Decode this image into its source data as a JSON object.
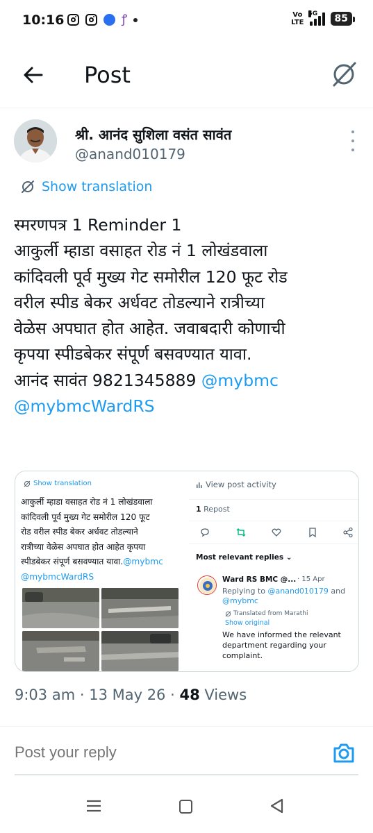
{
  "status_bar": {
    "time": "10:16",
    "network_label_top": "Vo",
    "network_label_bottom": "LTE",
    "network_5g": "5G",
    "battery": "85"
  },
  "header": {
    "title": "Post"
  },
  "author": {
    "name": "श्री. आनंद सुशिला वसंत सावंत",
    "handle": "@anand010179"
  },
  "translate_label": "Show translation",
  "post": {
    "lines": [
      "स्मरणपत्र 1 Reminder 1",
      "आकुर्ली म्हाडा वसाहत रोड नं 1 लोखंडवाला",
      "कांदिवली पूर्व मुख्य गेट समोरील 120 फूट रोड",
      "वरील स्पीड बेकर अर्धवट तोडल्याने रात्रीच्या",
      "वेळेस अपघात होत आहेत. जवाबदारी कोणाची",
      "कृपया स्पीडबेकर संपूर्ण बसवण्यात यावा."
    ],
    "last_line_text": "आनंद सावंत 9821345889 ",
    "mention_1": "@mybmc",
    "mention_2": "@mybmcWardRS"
  },
  "media": {
    "left": {
      "translate_label": "Show translation",
      "lines": [
        "आकुर्ली म्हाडा वसाहत रोड नं 1 लोखंडवाला",
        "कांदिवली पूर्व मुख्य गेट समोरील 120 फूट",
        "रोड वरील स्पीड बेकर अर्धवट तोडल्याने",
        "रात्रीच्या वेळेस अपघात होत आहेत कृपया"
      ],
      "line5_text": "स्पीडबेकर संपूर्ण बसवण्यात यावा.",
      "line5_mention": "@mybmc",
      "line6_mention": "@mybmcWardRS"
    },
    "right": {
      "activity_label": "View post activity",
      "repost_count": "1",
      "repost_label": " Repost",
      "relevant_label": "Most relevant replies ⌄",
      "reply": {
        "name": "Ward RS BMC @...",
        "date": "· 15 Apr",
        "replying_prefix": "Replying to ",
        "replying_mention_1": "@anand010179",
        "replying_and": " and ",
        "replying_mention_2": "@mybmc",
        "translated_label": "Translated from Marathi",
        "show_original": "Show original",
        "text": "We have informed the relevant department regarding your complaint."
      }
    }
  },
  "meta": {
    "time": "9:03 am",
    "sep1": " · ",
    "date": "13 May 26",
    "sep2": " · ",
    "views_count": "48",
    "views_label": " Views"
  },
  "reply_bar": {
    "placeholder": "Post your reply"
  },
  "colors": {
    "accent": "#1d9bf0",
    "text": "#0f1419",
    "secondary": "#536471",
    "retweet_green": "#00ba7c"
  }
}
